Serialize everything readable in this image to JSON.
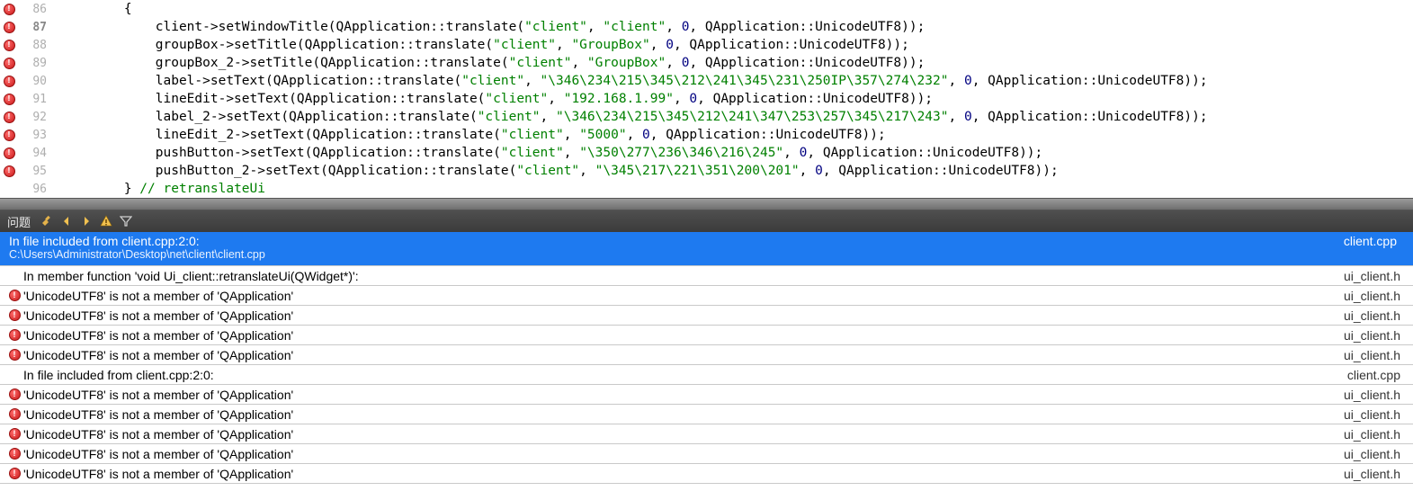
{
  "code": {
    "lines": [
      {
        "n": 86,
        "err": true,
        "indent": "        ",
        "text": "{"
      },
      {
        "n": 87,
        "err": true,
        "current": true,
        "indent": "            ",
        "stmt": {
          "lhs": "client",
          "fn": "setWindowTitle",
          "arg2": "\"client\""
        }
      },
      {
        "n": 88,
        "err": true,
        "indent": "            ",
        "stmt": {
          "lhs": "groupBox",
          "fn": "setTitle",
          "arg2": "\"GroupBox\""
        }
      },
      {
        "n": 89,
        "err": true,
        "indent": "            ",
        "stmt": {
          "lhs": "groupBox_2",
          "fn": "setTitle",
          "arg2": "\"GroupBox\""
        }
      },
      {
        "n": 90,
        "err": true,
        "indent": "            ",
        "stmt": {
          "lhs": "label",
          "fn": "setText",
          "arg2": "\"\\346\\234\\215\\345\\212\\241\\345\\231\\250IP\\357\\274\\232\""
        }
      },
      {
        "n": 91,
        "err": true,
        "indent": "            ",
        "stmt": {
          "lhs": "lineEdit",
          "fn": "setText",
          "arg2": "\"192.168.1.99\""
        }
      },
      {
        "n": 92,
        "err": true,
        "indent": "            ",
        "stmt": {
          "lhs": "label_2",
          "fn": "setText",
          "arg2": "\"\\346\\234\\215\\345\\212\\241\\347\\253\\257\\345\\217\\243\""
        }
      },
      {
        "n": 93,
        "err": true,
        "indent": "            ",
        "stmt": {
          "lhs": "lineEdit_2",
          "fn": "setText",
          "arg2": "\"5000\""
        }
      },
      {
        "n": 94,
        "err": true,
        "indent": "            ",
        "stmt": {
          "lhs": "pushButton",
          "fn": "setText",
          "arg2": "\"\\350\\277\\236\\346\\216\\245\""
        }
      },
      {
        "n": 95,
        "err": true,
        "indent": "            ",
        "stmt": {
          "lhs": "pushButton_2",
          "fn": "setText",
          "arg2": "\"\\345\\217\\221\\351\\200\\201\""
        }
      },
      {
        "n": 96,
        "err": false,
        "indent": "        ",
        "text": "}",
        "tail": " // retranslateUi"
      }
    ],
    "translate_prefix": "QApplication::translate(",
    "translate_arg1": "\"client\"",
    "translate_arg3": "0",
    "translate_arg4": "QApplication::UnicodeUTF8",
    "translate_close": "));"
  },
  "problemsPanel": {
    "title": "问题"
  },
  "problems": [
    {
      "selected": true,
      "icon": false,
      "text": "In file included from client.cpp:2:0:",
      "sub": "C:\\Users\\Administrator\\Desktop\\net\\client\\client.cpp",
      "file": "client.cpp"
    },
    {
      "selected": false,
      "icon": false,
      "text": "In member function 'void Ui_client::retranslateUi(QWidget*)':",
      "file": "ui_client.h"
    },
    {
      "selected": false,
      "icon": true,
      "text": "'UnicodeUTF8' is not a member of 'QApplication'",
      "file": "ui_client.h"
    },
    {
      "selected": false,
      "icon": true,
      "text": "'UnicodeUTF8' is not a member of 'QApplication'",
      "file": "ui_client.h"
    },
    {
      "selected": false,
      "icon": true,
      "text": "'UnicodeUTF8' is not a member of 'QApplication'",
      "file": "ui_client.h"
    },
    {
      "selected": false,
      "icon": true,
      "text": "'UnicodeUTF8' is not a member of 'QApplication'",
      "file": "ui_client.h"
    },
    {
      "selected": false,
      "icon": false,
      "text": "In file included from client.cpp:2:0:",
      "file": "client.cpp"
    },
    {
      "selected": false,
      "icon": true,
      "text": "'UnicodeUTF8' is not a member of 'QApplication'",
      "file": "ui_client.h"
    },
    {
      "selected": false,
      "icon": true,
      "text": "'UnicodeUTF8' is not a member of 'QApplication'",
      "file": "ui_client.h"
    },
    {
      "selected": false,
      "icon": true,
      "text": "'UnicodeUTF8' is not a member of 'QApplication'",
      "file": "ui_client.h"
    },
    {
      "selected": false,
      "icon": true,
      "text": "'UnicodeUTF8' is not a member of 'QApplication'",
      "file": "ui_client.h"
    },
    {
      "selected": false,
      "icon": true,
      "text": "'UnicodeUTF8' is not a member of 'QApplication'",
      "file": "ui_client.h"
    }
  ]
}
